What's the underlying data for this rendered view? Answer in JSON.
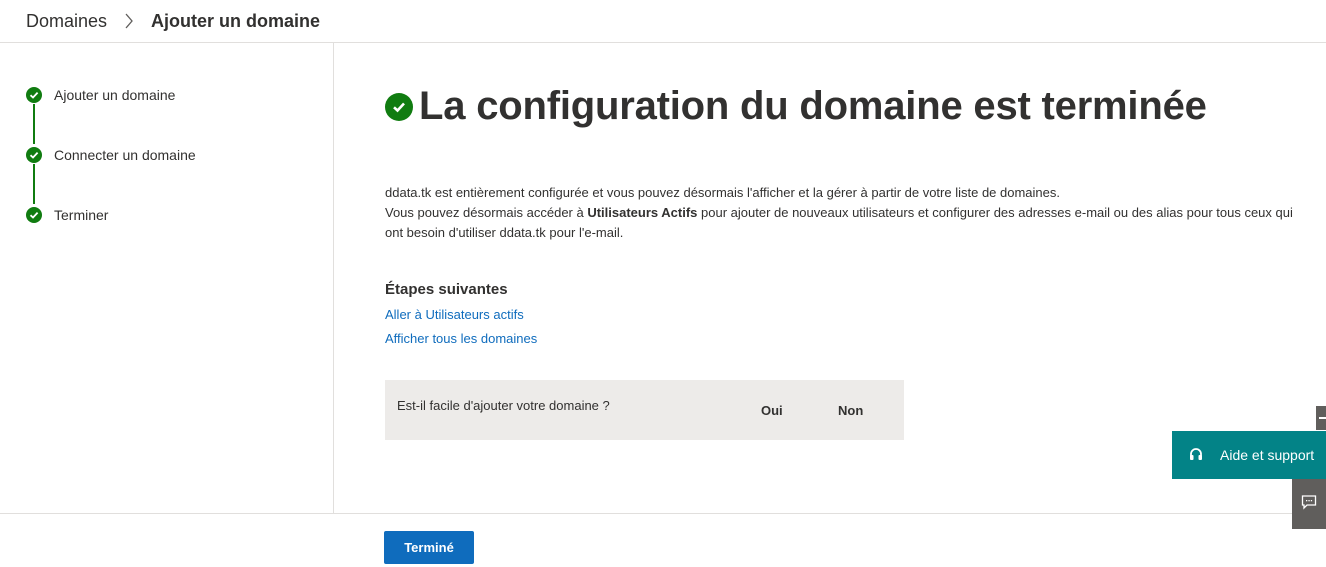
{
  "breadcrumb": {
    "parent": "Domaines",
    "current": "Ajouter un domaine"
  },
  "steps": [
    {
      "label": "Ajouter un domaine",
      "status": "complete"
    },
    {
      "label": "Connecter un domaine",
      "status": "complete"
    },
    {
      "label": "Terminer",
      "status": "complete"
    }
  ],
  "main": {
    "title": "La configuration du domaine est terminée",
    "desc_line1": "ddata.tk est entièrement configurée et vous pouvez désormais l'afficher et la gérer à partir de votre liste de domaines.",
    "desc_line2_before": "Vous pouvez désormais accéder à ",
    "desc_line2_bold": "Utilisateurs Actifs",
    "desc_line2_after": " pour ajouter de nouveaux utilisateurs et configurer des adresses e-mail ou des alias pour tous ceux qui ont besoin d'utiliser ddata.tk pour l'e-mail.",
    "next_steps_heading": "Étapes suivantes",
    "link_users": "Aller à Utilisateurs actifs",
    "link_domains": "Afficher tous les domaines"
  },
  "feedback": {
    "question": "Est-il facile d'ajouter votre domaine ?",
    "yes": "Oui",
    "no": "Non"
  },
  "footer": {
    "done_label": "Terminé"
  },
  "help": {
    "label": "Aide et support"
  },
  "colors": {
    "success": "#107c10",
    "link": "#0f6cbd",
    "primary_button": "#0f6cbd",
    "help_teal": "#038387",
    "feedback_bg": "#edebe9"
  },
  "icons": {
    "breadcrumb_separator": "chevron-right-icon",
    "step_status": "check-circle-icon",
    "help": "headset-icon",
    "chat": "chat-feedback-icon"
  }
}
